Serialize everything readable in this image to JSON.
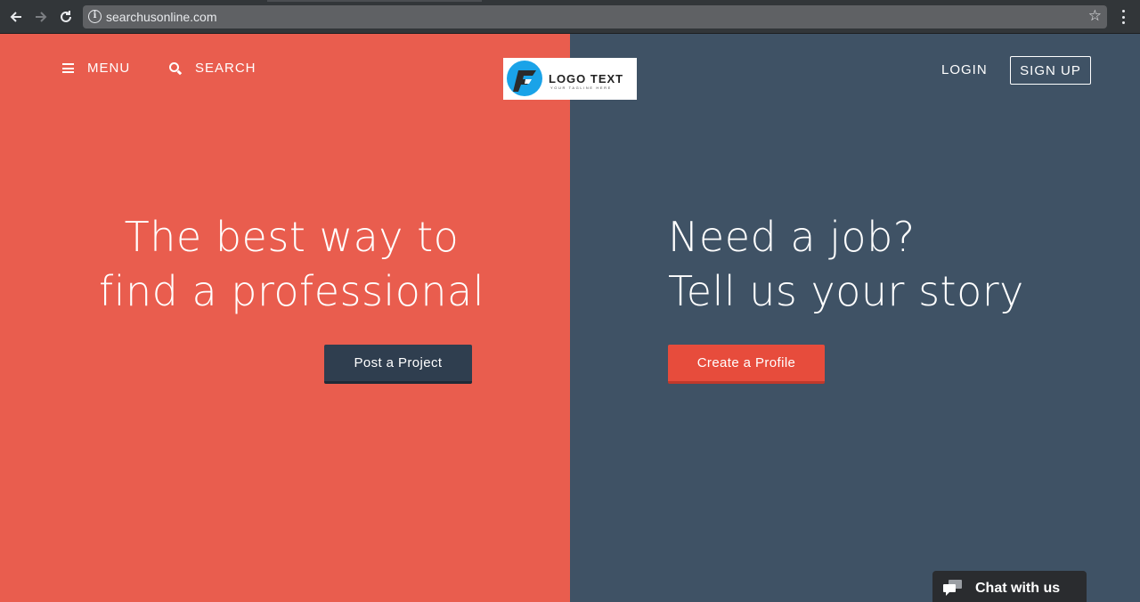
{
  "browser": {
    "url": "searchusonline.com",
    "back_icon": "arrow-left-icon",
    "forward_icon": "arrow-right-icon",
    "reload_icon": "reload-icon",
    "info_icon": "info-icon",
    "bookmark_icon": "star-icon",
    "menu_icon": "kebab-menu-icon"
  },
  "header": {
    "menu_label": "MENU",
    "search_label": "SEARCH",
    "logo": {
      "text": "LOGO TEXT",
      "tagline": "YOUR TAGLINE HERE"
    },
    "login_label": "LOGIN",
    "signup_label": "SIGN UP"
  },
  "hero_left": {
    "line1": "The best way to",
    "line2": "find a professional",
    "cta_label": "Post a Project"
  },
  "hero_right": {
    "line1": "Need a job?",
    "line2": "Tell us your story",
    "cta_label": "Create a Profile"
  },
  "chat": {
    "label": "Chat with us"
  },
  "colors": {
    "left_panel": "#e95d4e",
    "right_panel": "#3f5265",
    "post_button": "#2f3e4f",
    "profile_button": "#e74c3c",
    "logo_accent": "#1aa3e8"
  }
}
